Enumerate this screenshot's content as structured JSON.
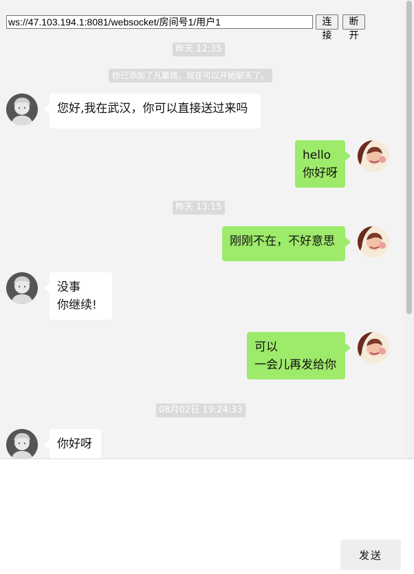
{
  "connection": {
    "url": "ws://47.103.194.1:8081/websocket/房间号1/用户1",
    "connect_label": "连接",
    "disconnect_label": "断开"
  },
  "messages": {
    "t1": "昨天 12:35",
    "sys1": "你已添加了凡繁烦，现在可以开始聊天了。",
    "m1": {
      "line1": "您好,我在武汉，你可以直接送过来吗"
    },
    "m2": {
      "line1": "hello",
      "line2": "你好呀"
    },
    "t2": "昨天 13:15",
    "m3": {
      "line1": "刚刚不在，不好意思"
    },
    "m4": {
      "line1": "没事",
      "line2": "你继续!"
    },
    "m5": {
      "line1": "可以",
      "line2": "一会儿再发给你"
    },
    "t3": "08月02日 19:24:33",
    "m6": {
      "line1": "你好呀"
    }
  },
  "composer": {
    "send_label": "发送"
  },
  "colors": {
    "background": "#f3f3f3",
    "self_bubble": "#9eea6a",
    "other_bubble": "#ffffff",
    "timestamp_bg": "#dadada"
  },
  "icons": {
    "other_avatar": "boy-avatar-icon",
    "self_avatar": "girl-avatar-icon"
  }
}
